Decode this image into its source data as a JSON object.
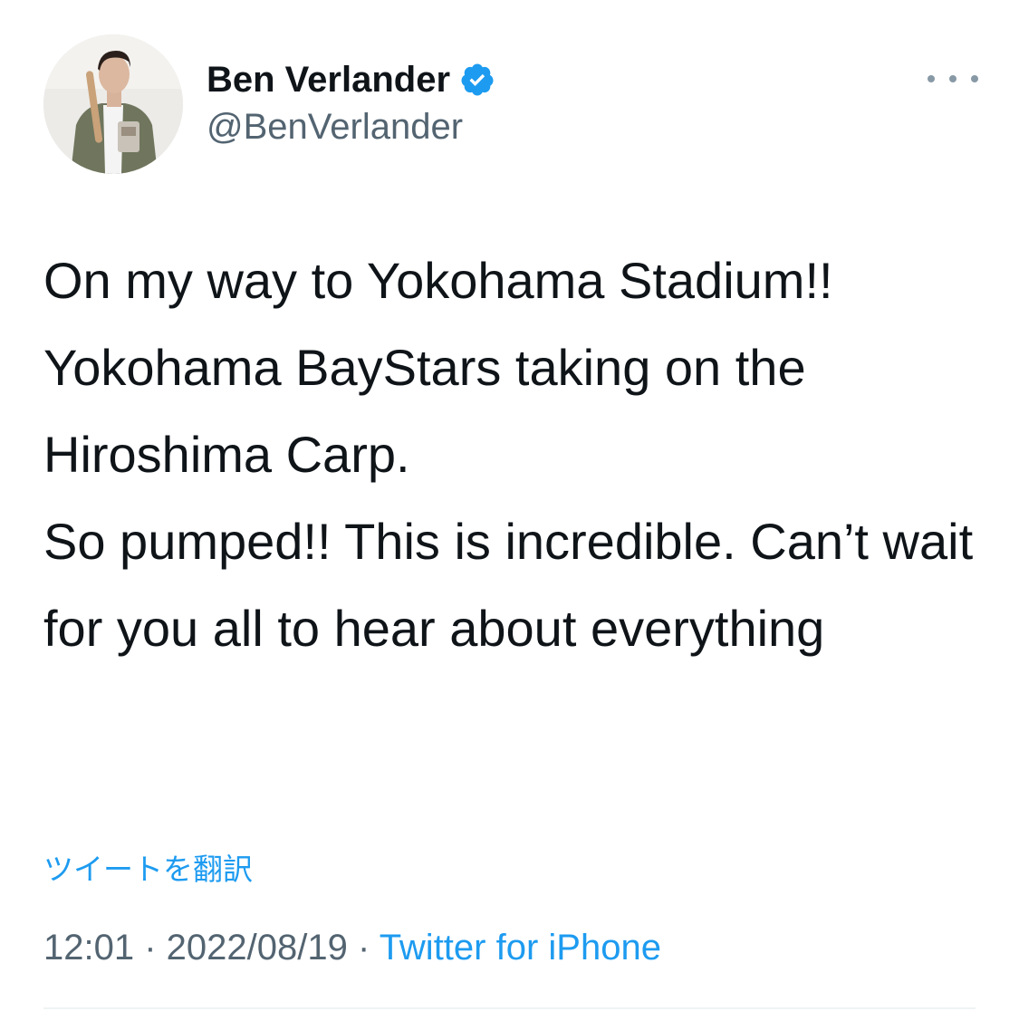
{
  "tweet": {
    "author": {
      "display_name": "Ben Verlander",
      "handle": "@BenVerlander",
      "verified": true
    },
    "paragraphs": [
      "On my way to Yokohama Stadium!!",
      "Yokohama BayStars taking on the Hiroshima Carp.",
      "So pumped!! This is incredible. Can’t wait for you all to hear about everything"
    ],
    "translate_label": "ツイートを翻訳",
    "time": "12:01",
    "date": "2022/08/19",
    "separator": " · ",
    "source": "Twitter for iPhone"
  },
  "icons": {
    "verified": "verified-badge-icon",
    "more": "more-options-icon"
  },
  "colors": {
    "text": "#0f1419",
    "secondary": "#536471",
    "accent": "#1d9bf0",
    "verified": "#1d9bf0"
  }
}
